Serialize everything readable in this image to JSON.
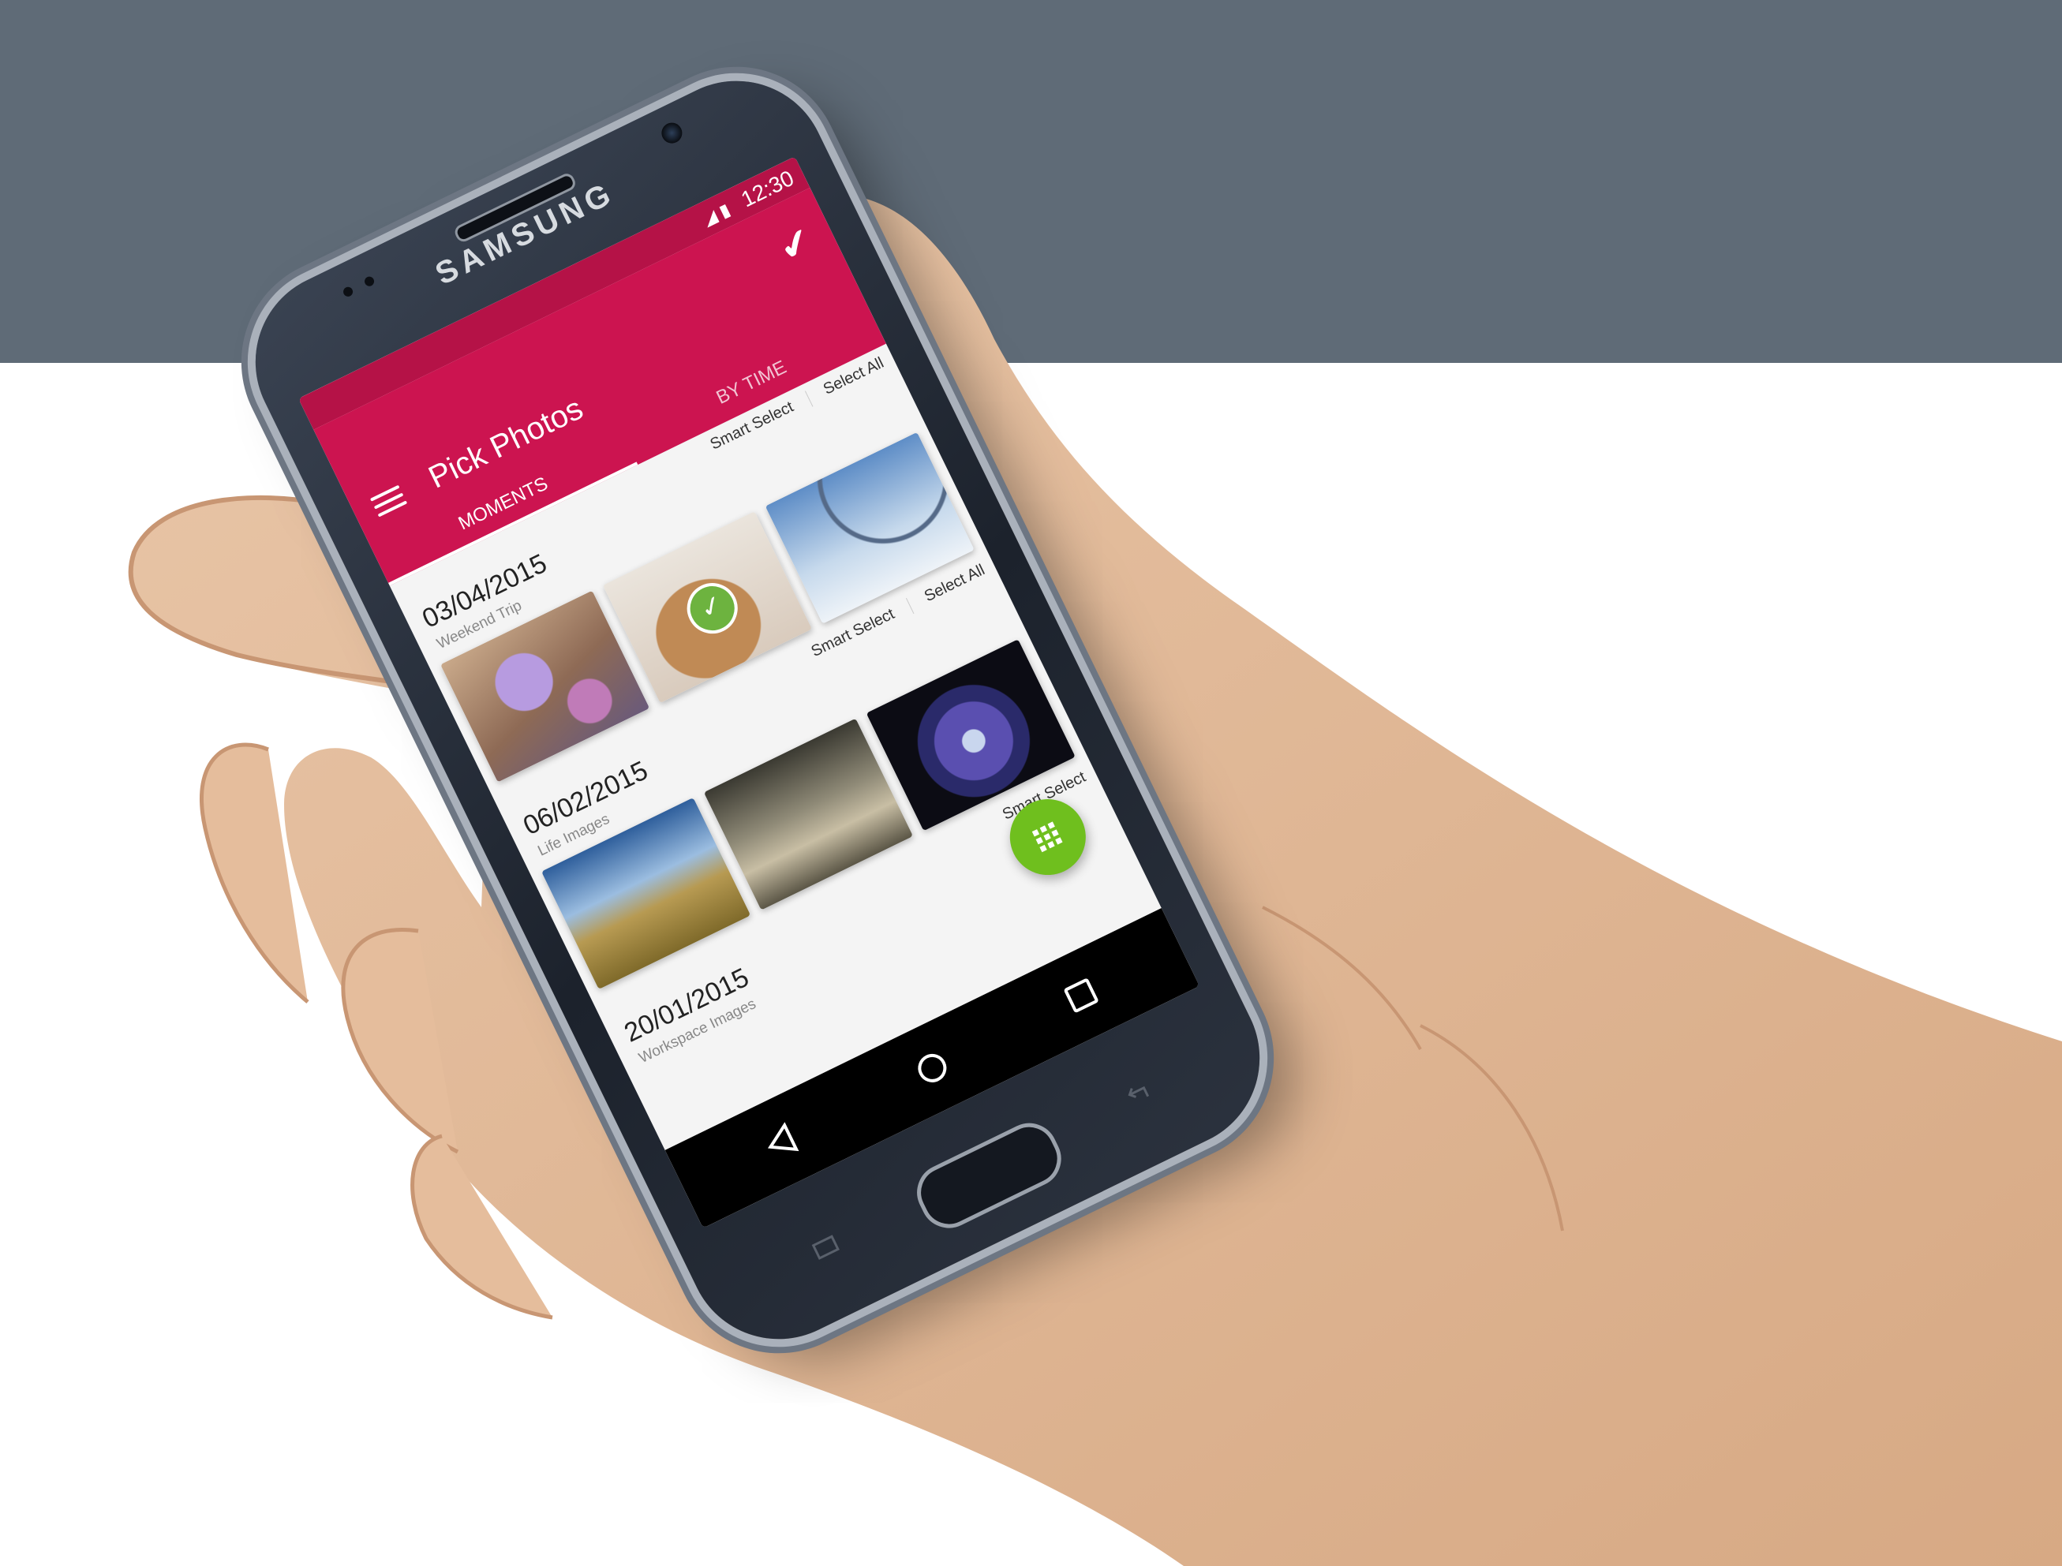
{
  "device": {
    "brand": "SAMSUNG"
  },
  "status_bar": {
    "time": "12:30",
    "signal_icon": "signal-icon",
    "battery_icon": "battery-icon"
  },
  "app_bar": {
    "title": "Pick Photos",
    "menu_icon": "hamburger-menu-icon",
    "confirm_icon": "checkmark-icon",
    "tabs": [
      {
        "label": "MOMENTS",
        "selected": true
      },
      {
        "label": "BY TIME",
        "selected": false
      }
    ]
  },
  "sections": [
    {
      "date": "03/04/2015",
      "subtitle": "Weekend Trip",
      "smart_select": "Smart Select",
      "select_all": "Select All",
      "photos": [
        {
          "name": "lavender-spa-photo",
          "selected": false
        },
        {
          "name": "knit-yarn-photo",
          "selected": true
        },
        {
          "name": "ferris-wheel-photo",
          "selected": false
        }
      ]
    },
    {
      "date": "06/02/2015",
      "subtitle": "Life Images",
      "smart_select": "Smart Select",
      "select_all": "Select All",
      "photos": [
        {
          "name": "hills-landscape-photo",
          "selected": false
        },
        {
          "name": "misty-forest-photo",
          "selected": false
        },
        {
          "name": "purple-flower-photo",
          "selected": false
        }
      ]
    },
    {
      "date": "20/01/2015",
      "subtitle": "Workspace Images",
      "smart_select": "Smart Select",
      "select_all": "",
      "photos": []
    }
  ],
  "fab": {
    "icon": "grid-icon",
    "color": "#6fbf1e"
  },
  "nav_bar": {
    "back_icon": "back-triangle-icon",
    "home_icon": "home-circle-icon",
    "recents_icon": "recents-square-icon"
  },
  "colors": {
    "primary": "#cc1450",
    "primary_dark": "#b51247",
    "backdrop": "#5f6b77"
  }
}
